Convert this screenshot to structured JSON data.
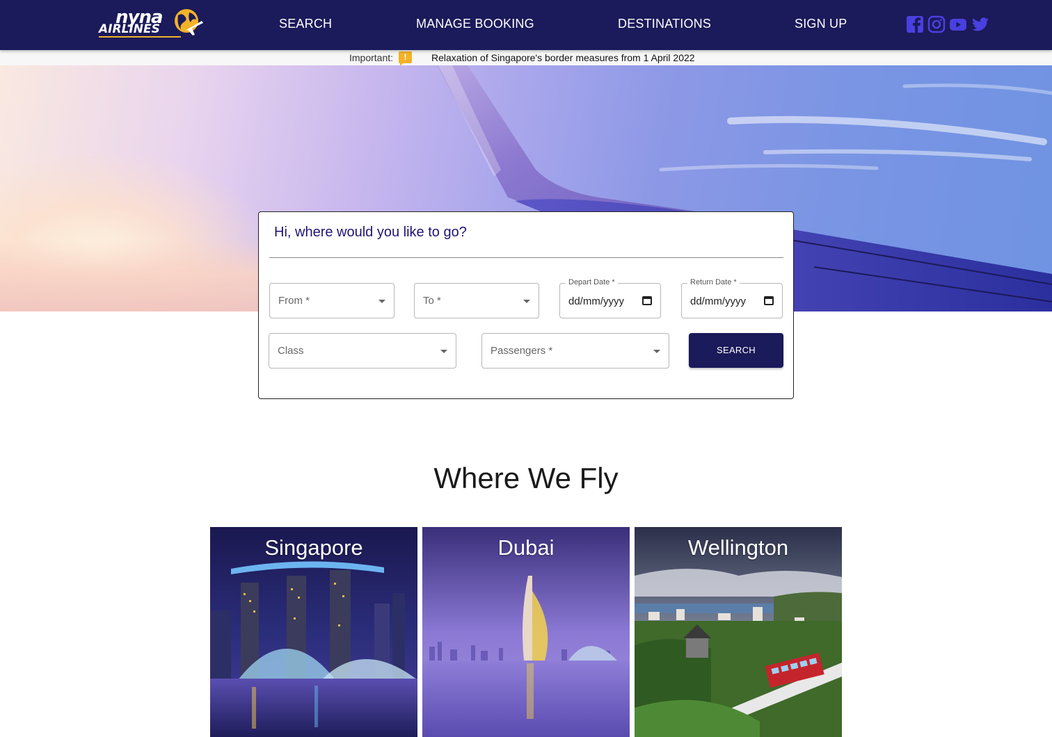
{
  "brand": {
    "logo_line1": "nyna",
    "logo_line2": "AIRLINES",
    "primary_color": "#1b1a5a",
    "accent_color": "#f4b227",
    "social_color": "#4a3fe0"
  },
  "nav": {
    "items": [
      {
        "label": "SEARCH"
      },
      {
        "label": "MANAGE BOOKING"
      },
      {
        "label": "DESTINATIONS"
      },
      {
        "label": "SIGN UP"
      }
    ],
    "social": [
      "facebook-icon",
      "instagram-icon",
      "youtube-icon",
      "twitter-icon"
    ]
  },
  "announcement": {
    "label": "Important:",
    "icon": "!",
    "text": "Relaxation of Singapore's border measures from 1 April 2022"
  },
  "search_card": {
    "title": "Hi, where would you like to go?",
    "from_label": "From *",
    "to_label": "To *",
    "depart_legend": "Depart Date *",
    "depart_value": "dd/mm/yyyy",
    "return_legend": "Return Date *",
    "return_value": "dd/mm/yyyy",
    "class_label": "Class",
    "passengers_label": "Passengers *",
    "search_button": "SEARCH"
  },
  "destinations": {
    "title": "Where We Fly",
    "items": [
      {
        "name": "Singapore"
      },
      {
        "name": "Dubai"
      },
      {
        "name": "Wellington"
      }
    ]
  }
}
